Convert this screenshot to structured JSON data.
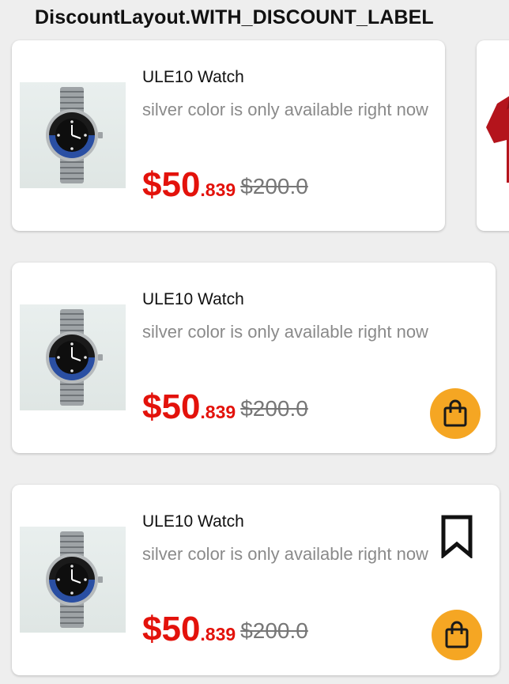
{
  "heading": "DiscountLayout.WITH_DISCOUNT_LABEL",
  "colors": {
    "price": "#e3120b",
    "accent": "#f5a623",
    "background": "#eeeeee"
  },
  "products": [
    {
      "title": "ULE10 Watch",
      "description": "silver color is only available right now",
      "price_main": "$50",
      "price_cents": ".839",
      "original_price": "$200.0",
      "image": "watch-image",
      "actions": []
    },
    {
      "title": "ULE10 Watch",
      "description": "silver color is only available right now",
      "price_main": "$50",
      "price_cents": ".839",
      "original_price": "$200.0",
      "image": "watch-image",
      "actions": [
        "shopping-bag-icon"
      ]
    },
    {
      "title": "ULE10 Watch",
      "description": "silver color is only available right now",
      "price_main": "$50",
      "price_cents": ".839",
      "original_price": "$200.0",
      "image": "watch-image",
      "actions": [
        "bookmark-icon",
        "shopping-bag-icon"
      ]
    }
  ],
  "partial_card": {
    "image": "red-shirt-image"
  }
}
